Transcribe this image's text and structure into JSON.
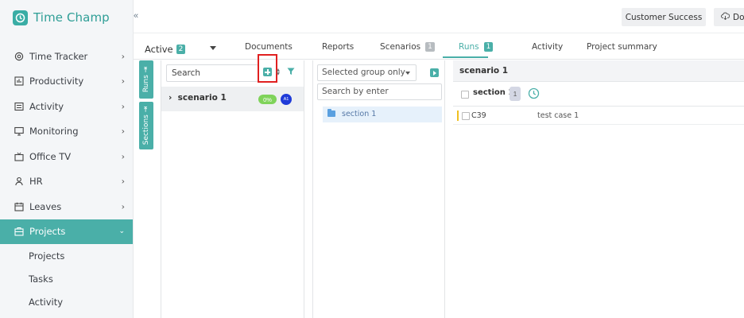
{
  "brand": {
    "name": "Time Champ",
    "color": "#3aada5"
  },
  "topbar": {
    "collapse_glyph": "«",
    "customer_success": "Customer Success",
    "download_label": "Do"
  },
  "sidebar": {
    "items": [
      {
        "label": "Time Tracker",
        "icon": "clock-icon"
      },
      {
        "label": "Productivity",
        "icon": "bar-chart-icon"
      },
      {
        "label": "Activity",
        "icon": "activity-icon"
      },
      {
        "label": "Monitoring",
        "icon": "monitor-icon"
      },
      {
        "label": "Office TV",
        "icon": "tv-icon"
      },
      {
        "label": "HR",
        "icon": "person-icon"
      },
      {
        "label": "Leaves",
        "icon": "calendar-icon"
      },
      {
        "label": "Projects",
        "icon": "briefcase-icon",
        "active": true
      }
    ],
    "sub_items": [
      "Projects",
      "Tasks",
      "Activity"
    ],
    "active_color": "#4aafa8"
  },
  "tabs": {
    "active_label": "Active",
    "active_count": "2",
    "documents": "Documents",
    "reports": "Reports",
    "scenarios": "Scenarios",
    "scenarios_count": "1",
    "runs": "Runs",
    "runs_count": "1",
    "activity": "Activity",
    "project_summary": "Project summary"
  },
  "side_tabs": {
    "runs": "Runs ⇥",
    "sections": "Sections ⇥"
  },
  "scenarios_panel": {
    "search_placeholder": "Search",
    "scenario_name": "scenario 1",
    "progress": "0%",
    "avatar_initials": "A1"
  },
  "sections_panel": {
    "group_select": "Selected group only",
    "search_placeholder": "Search by enter",
    "section_name": "section 1"
  },
  "runs_panel": {
    "title": "scenario 1",
    "section_name": "section 1",
    "section_count": "1",
    "case_id": "C39",
    "case_name": "test case 1"
  }
}
